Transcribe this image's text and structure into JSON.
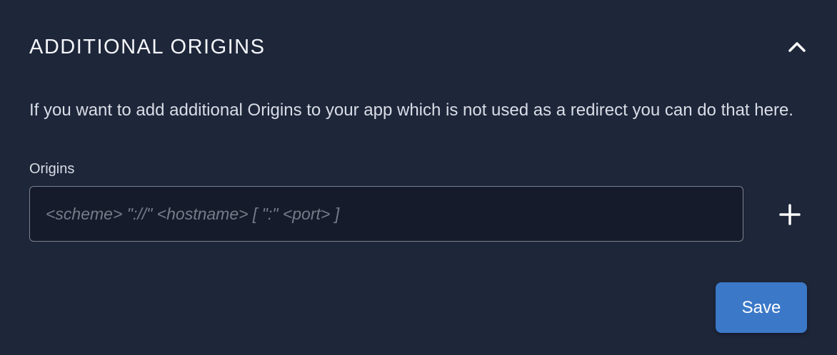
{
  "section": {
    "title": "ADDITIONAL ORIGINS",
    "collapse_icon": "chevron-up-icon",
    "description": "If you want to add additional Origins to your app which is not used as a redirect you can do that here."
  },
  "origins": {
    "label": "Origins",
    "value": "",
    "placeholder": "<scheme> \"://\" <hostname> [ \":\" <port> ]",
    "add_icon": "plus-icon"
  },
  "actions": {
    "save_label": "Save"
  },
  "colors": {
    "background": "#1e263a",
    "input_background": "#151b2a",
    "accent": "#3b78c8"
  }
}
